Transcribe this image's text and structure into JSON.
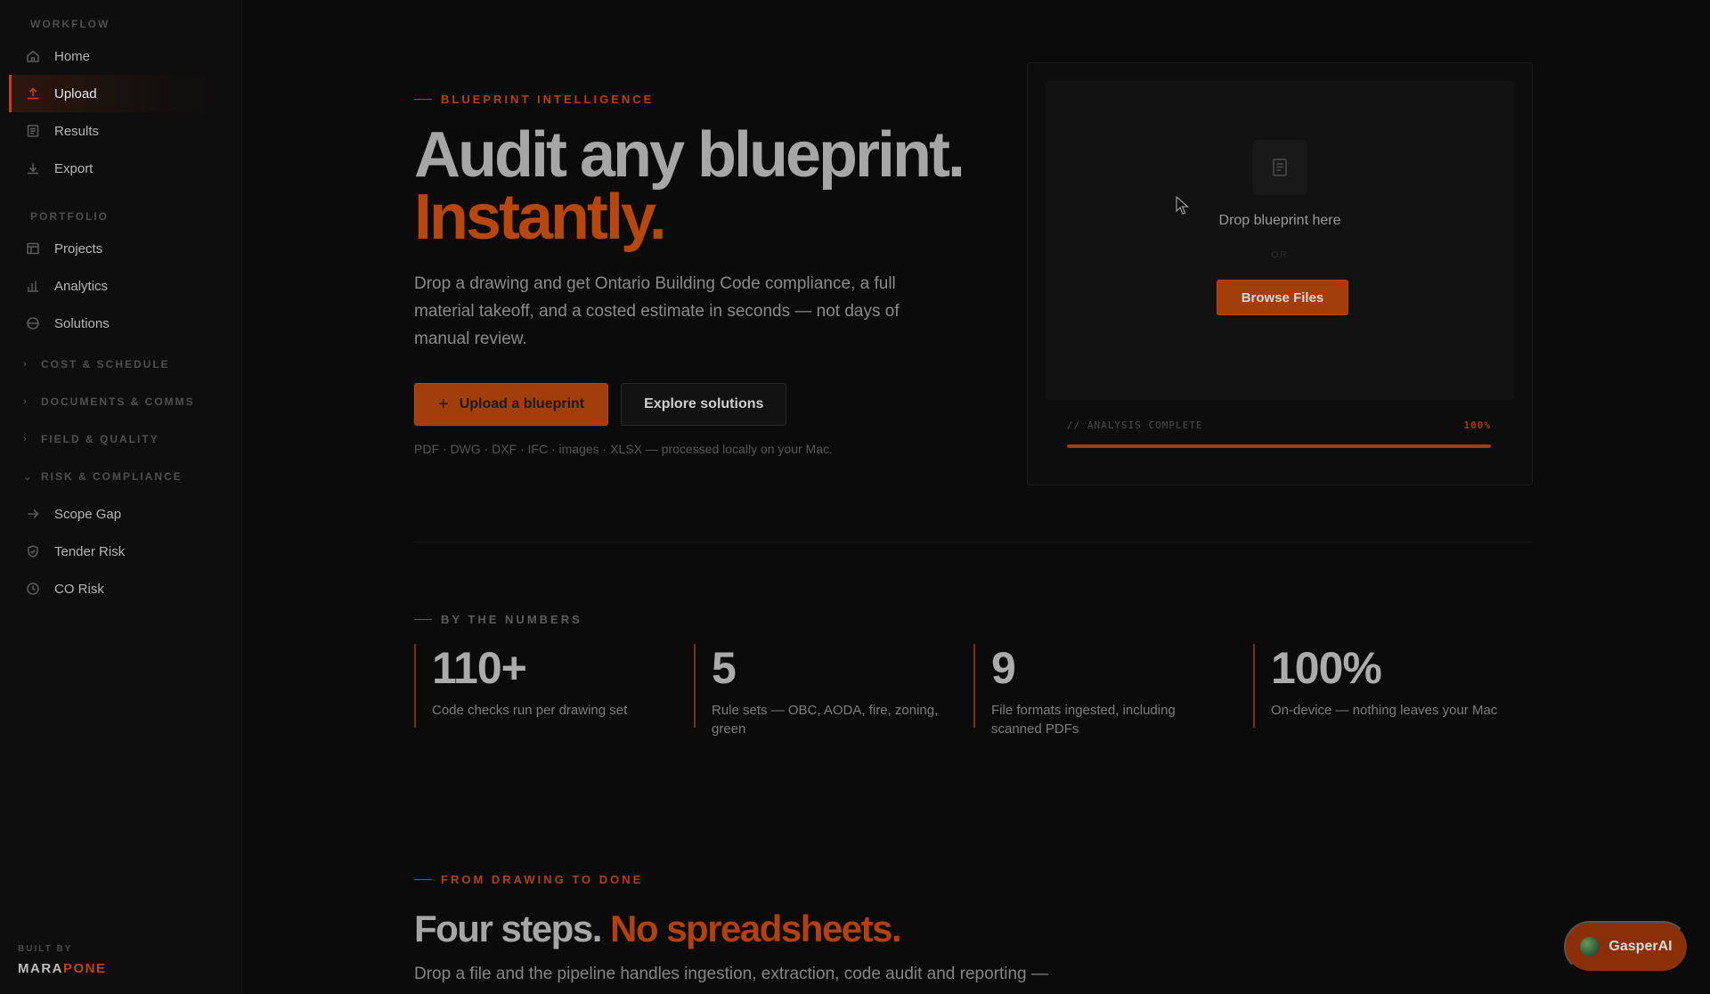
{
  "sidebar": {
    "section_workflow": "WORKFLOW",
    "workflow_items": [
      {
        "label": "Home",
        "icon": "home-icon"
      },
      {
        "label": "Upload",
        "icon": "upload-icon",
        "active": true
      },
      {
        "label": "Results",
        "icon": "results-icon"
      },
      {
        "label": "Export",
        "icon": "export-icon"
      }
    ],
    "section_portfolio": "PORTFOLIO",
    "portfolio_items": [
      {
        "label": "Projects",
        "icon": "projects-icon"
      },
      {
        "label": "Analytics",
        "icon": "bar-chart-icon"
      },
      {
        "label": "Solutions",
        "icon": "solutions-icon"
      }
    ],
    "groups": [
      {
        "label": "COST & SCHEDULE",
        "expanded": false
      },
      {
        "label": "DOCUMENTS & COMMS",
        "expanded": false
      },
      {
        "label": "FIELD & QUALITY",
        "expanded": false
      },
      {
        "label": "RISK & COMPLIANCE",
        "expanded": true
      }
    ],
    "risk_items": [
      {
        "label": "Scope Gap",
        "icon": "arrow-right-icon"
      },
      {
        "label": "Tender Risk",
        "icon": "shield-icon"
      },
      {
        "label": "CO Risk",
        "icon": "clock-icon"
      }
    ],
    "footer": {
      "built_by": "BUILT BY",
      "brand_a": "MARA",
      "brand_b": "PONE"
    }
  },
  "hero": {
    "eyebrow": "BLUEPRINT INTELLIGENCE",
    "title_line1": "Audit any blueprint.",
    "title_line2": "Instantly.",
    "subtitle": "Drop a drawing and get Ontario Building Code compliance, a full material takeoff, and a costed estimate in seconds — not days of manual review.",
    "primary_cta": "Upload a blueprint",
    "secondary_cta": "Explore solutions",
    "formats_note": "PDF · DWG · DXF · IFC · images · XLSX — processed locally on your Mac."
  },
  "dropzone": {
    "title": "Drop blueprint here",
    "or": "OR",
    "browse": "Browse Files",
    "analysis_label": "// ANALYSIS COMPLETE",
    "analysis_pct": "100%",
    "progress": 1.0
  },
  "numbers": {
    "eyebrow": "BY THE NUMBERS",
    "stats": [
      {
        "value": "110+",
        "desc": "Code checks run per drawing set"
      },
      {
        "value": "5",
        "desc": "Rule sets — OBC, AODA, fire, zoning, green"
      },
      {
        "value": "9",
        "desc": "File formats ingested, including scanned PDFs"
      },
      {
        "value": "100%",
        "desc": "On-device — nothing leaves your Mac"
      }
    ]
  },
  "steps": {
    "eyebrow": "FROM DRAWING TO DONE",
    "title_a": "Four steps.",
    "title_b": "No spreadsheets.",
    "subtitle": "Drop a file and the pipeline handles ingestion, extraction, code audit and reporting —"
  },
  "assistant": {
    "label": "GasperAI"
  },
  "colors": {
    "accent": "#b8460f",
    "background": "#0b0b0b",
    "sidebar": "#0e0e0e"
  }
}
